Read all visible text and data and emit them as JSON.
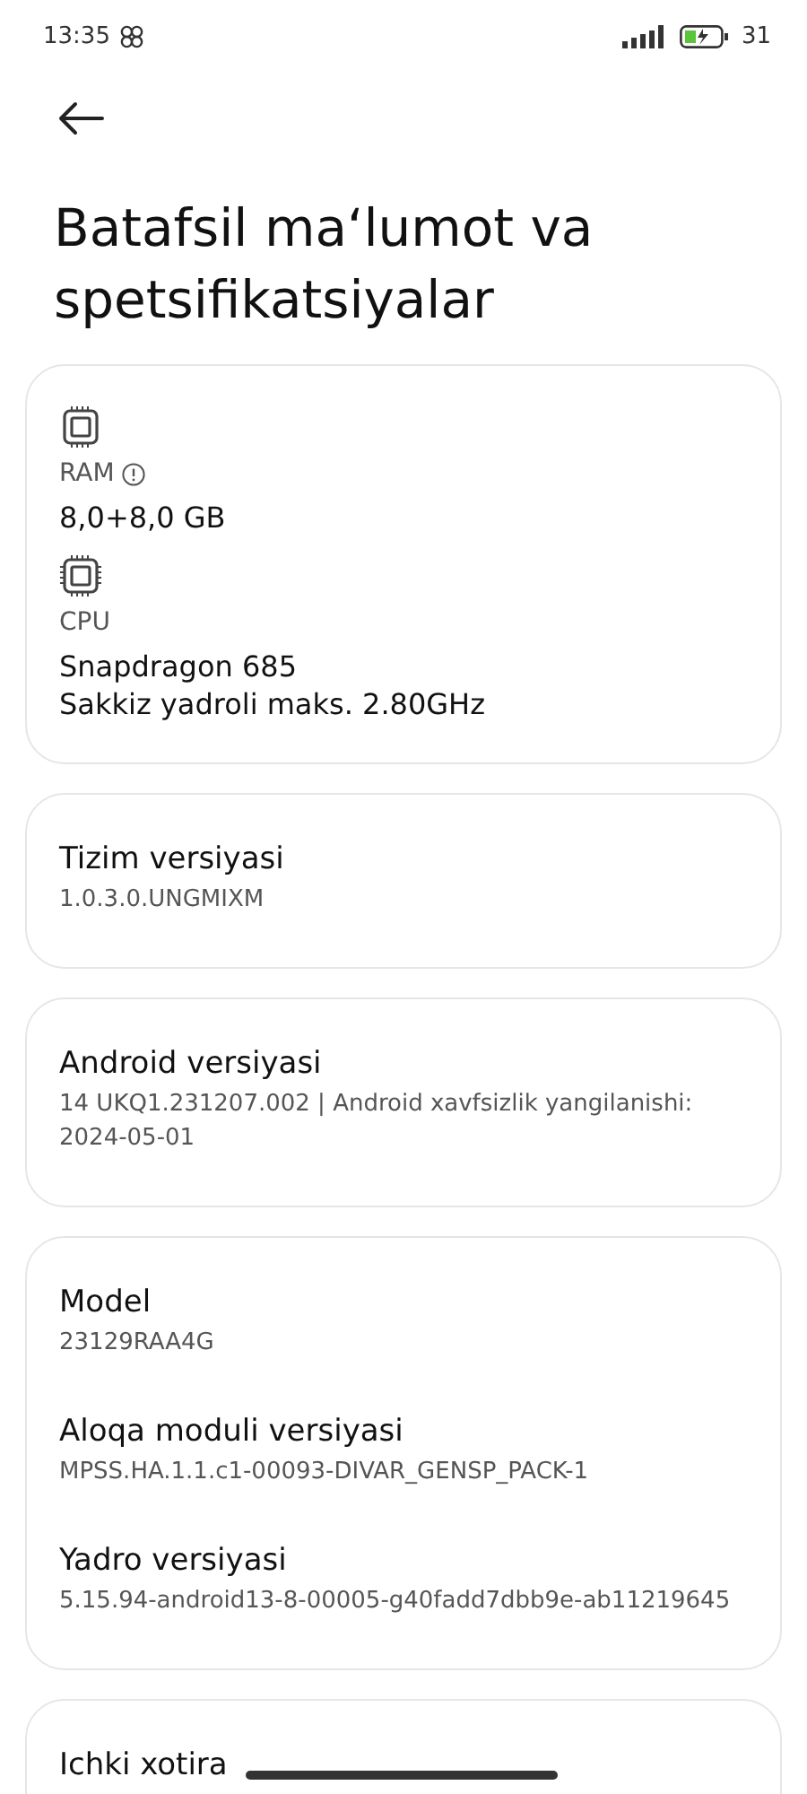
{
  "status_bar": {
    "time": "13:35",
    "battery_percent": "31"
  },
  "header": {
    "title": "Batafsil maʻlumot va spetsifikatsiyalar"
  },
  "cards": [
    {
      "kind": "specs",
      "items": [
        {
          "label": "RAM",
          "info": true,
          "value": "8,0+8,0 GB"
        },
        {
          "label": "CPU",
          "info": false,
          "value": "Snapdragon 685\nSakkiz yadroli maks. 2.80GHz"
        }
      ]
    },
    {
      "kind": "fields",
      "items": [
        {
          "label": "Tizim versiyasi",
          "value": "1.0.3.0.UNGMIXM"
        }
      ]
    },
    {
      "kind": "fields",
      "items": [
        {
          "label": "Android versiyasi",
          "value": "14 UKQ1.231207.002 | Android xavfsizlik yangilanishi: 2024-05-01"
        }
      ]
    },
    {
      "kind": "fields",
      "items": [
        {
          "label": "Model",
          "value": "23129RAA4G"
        },
        {
          "label": "Aloqa moduli versiyasi",
          "value": "MPSS.HA.1.1.c1-00093-DIVAR_GENSP_PACK-1"
        },
        {
          "label": "Yadro versiyasi",
          "value": "5.15.94-android13-8-00005-g40fadd7dbb9e-ab11219645"
        }
      ]
    },
    {
      "kind": "fields",
      "items": [
        {
          "label": "Ichki xotira"
        }
      ]
    }
  ]
}
